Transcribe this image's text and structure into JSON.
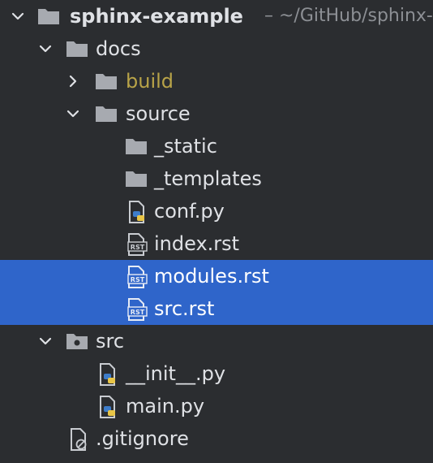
{
  "project": {
    "name": "sphinx-example",
    "path": "– ~/GitHub/sphinx-example"
  },
  "tree": {
    "docs": "docs",
    "build": "build",
    "source": "source",
    "static": "_static",
    "templates": "_templates",
    "conf": "conf.py",
    "index": "index.rst",
    "modules": "modules.rst",
    "srcrst": "src.rst",
    "src": "src",
    "init": "__init__.py",
    "main": "main.py",
    "gitignore": ".gitignore"
  },
  "icons": {
    "folder": "folder-icon",
    "module": "module-folder-icon",
    "python": "python-file-icon",
    "rst": "rst-file-icon",
    "ignored": "ignored-file-icon",
    "expanded": "chevron-down-icon",
    "collapsed": "chevron-right-icon"
  },
  "colors": {
    "background": "#2b2d30",
    "selection": "#2f65ca",
    "text": "#dfe1e5",
    "muted": "#8c8f94",
    "excluded": "#b8a348",
    "folder": "#a7aab0"
  }
}
